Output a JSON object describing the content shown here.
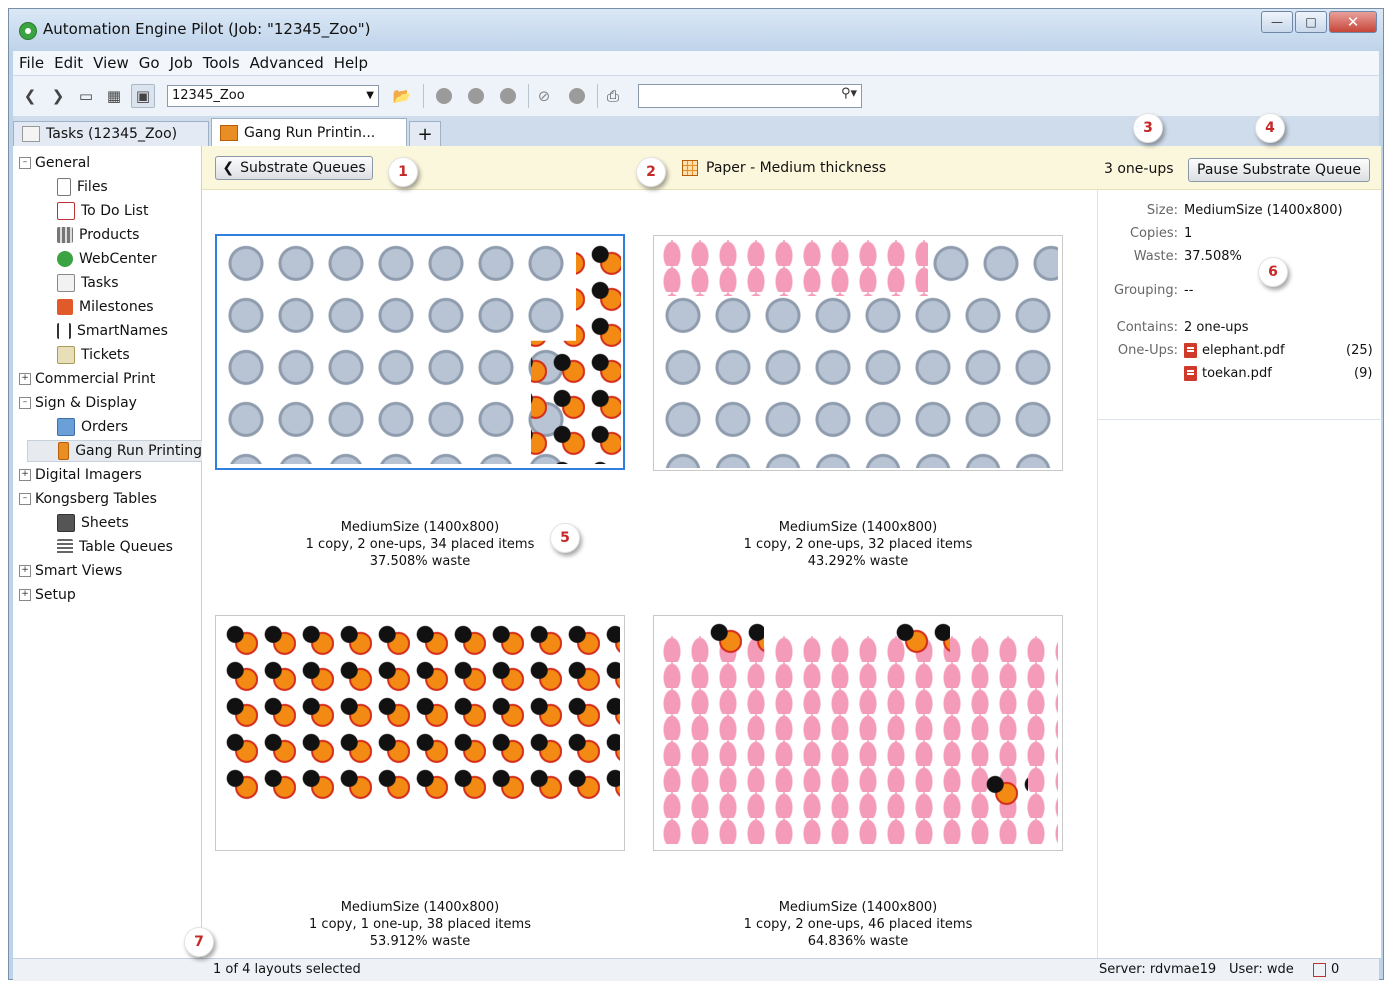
{
  "window": {
    "title": "Automation Engine Pilot (Job: \"12345_Zoo\")"
  },
  "menu": [
    "File",
    "Edit",
    "View",
    "Go",
    "Job",
    "Tools",
    "Advanced",
    "Help"
  ],
  "toolbar": {
    "job_combo": "12345_Zoo",
    "search_value": ""
  },
  "tabs": [
    {
      "label": "Tasks (12345_Zoo)"
    },
    {
      "label": "Gang Run Printin..."
    },
    {
      "label": "+"
    }
  ],
  "sidebar": {
    "general": "General",
    "files": "Files",
    "todo": "To Do List",
    "products": "Products",
    "webcenter": "WebCenter",
    "tasks": "Tasks",
    "milestones": "Milestones",
    "smartnames": "SmartNames",
    "tickets": "Tickets",
    "commercial_print": "Commercial Print",
    "sign_display": "Sign & Display",
    "orders": "Orders",
    "gang_run": "Gang Run Printing",
    "digital_imagers": "Digital Imagers",
    "kongsberg": "Kongsberg Tables",
    "sheets": "Sheets",
    "table_queues": "Table Queues",
    "smart_views": "Smart Views",
    "setup": "Setup"
  },
  "crumb": {
    "back_label": "Substrate Queues",
    "title": "Paper - Medium thickness",
    "oneups": "3 one-ups",
    "pause_label": "Pause Substrate Queue"
  },
  "layouts": [
    {
      "l1": "MediumSize (1400x800)",
      "l2": "1 copy, 2 one-ups, 34 placed items",
      "l3": "37.508% waste"
    },
    {
      "l1": "MediumSize (1400x800)",
      "l2": "1 copy, 2 one-ups, 32 placed items",
      "l3": "43.292% waste"
    },
    {
      "l1": "MediumSize (1400x800)",
      "l2": "1 copy, 1 one-up, 38 placed items",
      "l3": "53.912% waste"
    },
    {
      "l1": "MediumSize (1400x800)",
      "l2": "1 copy, 2 one-ups, 46 placed items",
      "l3": "64.836% waste"
    }
  ],
  "info": {
    "size_label": "Size:",
    "size": "MediumSize (1400x800)",
    "copies_label": "Copies:",
    "copies": "1",
    "waste_label": "Waste:",
    "waste": "37.508%",
    "grouping_label": "Grouping:",
    "grouping": "--",
    "contains_label": "Contains:",
    "contains": "2 one-ups",
    "oneups_label": "One-Ups:",
    "files": [
      {
        "name": "elephant.pdf",
        "count": "(25)"
      },
      {
        "name": "toekan.pdf",
        "count": "(9)"
      }
    ]
  },
  "status": {
    "selection": "1 of 4 layouts selected",
    "server": "Server: rdvmae19",
    "user": "User: wde",
    "todo_count": "0"
  },
  "callouts": [
    "1",
    "2",
    "3",
    "4",
    "5",
    "6",
    "7"
  ]
}
